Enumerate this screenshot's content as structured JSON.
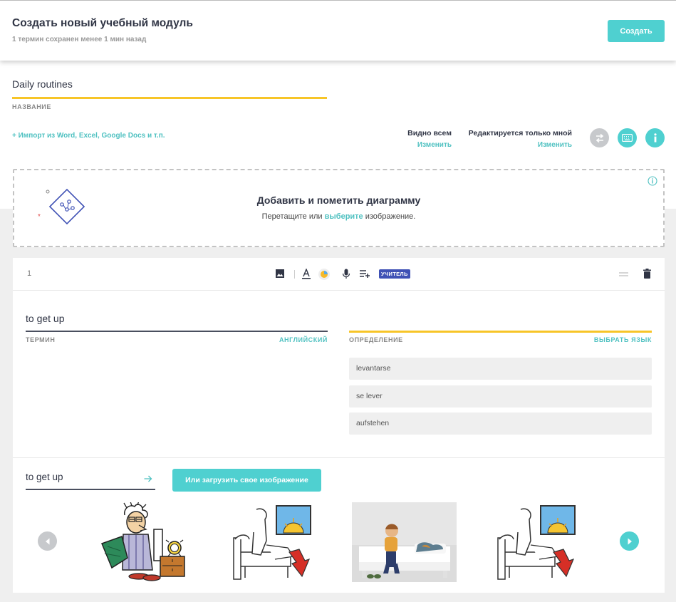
{
  "header": {
    "title": "Создать новый учебный модуль",
    "subtitle": "1 термин сохранен менее 1 мин назад",
    "create_button": "Создать"
  },
  "set": {
    "title_value": "Daily routines",
    "title_label": "НАЗВАНИЕ",
    "import_link": "+ Импорт из Word, Excel, Google Docs и т.п.",
    "visibility": {
      "label": "Видно всем",
      "change": "Изменить"
    },
    "editing": {
      "label": "Редактируется только мной",
      "change": "Изменить"
    },
    "icons": {
      "swap": "swap-icon",
      "keyboard": "keyboard-icon",
      "info": "info-icon"
    }
  },
  "diagram": {
    "title": "Добавить и пометить диаграмму",
    "subtitle_before": "Перетащите или ",
    "subtitle_link": "выберите",
    "subtitle_after": " изображение."
  },
  "card": {
    "number": "1",
    "toolbar": [
      "image-icon",
      "text-format-icon",
      "color-icon",
      "microphone-icon",
      "add-list-icon"
    ],
    "teacher_badge": "УЧИТЕЛЬ",
    "term": {
      "value": "to get up",
      "label": "ТЕРМИН",
      "language": "АНГЛИЙСКИЙ"
    },
    "definition": {
      "label": "ОПРЕДЕЛЕНИЕ",
      "language": "ВЫБРАТЬ ЯЗЫК",
      "suggestions": [
        "levantarse",
        "se lever",
        "aufstehen"
      ]
    },
    "image_search": {
      "query": "to get up",
      "upload_button": "Или загрузить свое изображение",
      "results": [
        "cartoon-man-waking-image",
        "sketch-bed-sunrise-image",
        "child-on-bed-photo",
        "sketch-bed-sunrise-image-2"
      ]
    }
  },
  "colors": {
    "accent": "#4fd0d0",
    "link": "#4fc1c1",
    "underline_yellow": "#f7c528",
    "badge": "#3f51b5",
    "icon_gray": "#c7c9cc"
  }
}
